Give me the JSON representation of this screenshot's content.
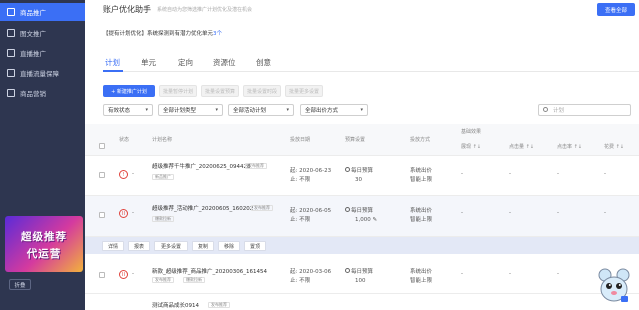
{
  "sidebar": {
    "items": [
      {
        "label": "商品推广",
        "icon": "goods-icon",
        "active": true
      },
      {
        "label": "图文推广",
        "icon": "image-text-icon",
        "active": false
      },
      {
        "label": "直播推广",
        "icon": "live-icon",
        "active": false
      },
      {
        "label": "直播流量保障",
        "icon": "live-traffic-icon",
        "active": false
      },
      {
        "label": "商品营销",
        "icon": "marketing-icon",
        "active": false
      }
    ],
    "promo": {
      "line1": "超级推荐",
      "line2": "代运营"
    },
    "collapse_label": "折叠"
  },
  "header": {
    "title": "账户优化助手",
    "subtitle": "系统自动为您筛选推广计划优化及潜在机会",
    "view_all": "查看全部",
    "notice_prefix": "【提有计划优化】系统探测到有潜力优化单元",
    "notice_count": "3个"
  },
  "tabs": [
    {
      "label": "计划",
      "active": true
    },
    {
      "label": "单元",
      "active": false
    },
    {
      "label": "定向",
      "active": false
    },
    {
      "label": "资源位",
      "active": false
    },
    {
      "label": "创意",
      "active": false
    }
  ],
  "toolbar": {
    "new_plan": "+ 新建推广计划",
    "batch_pause": "批量暂停计划",
    "batch_budget": "批量设置预算",
    "batch_schedule": "批量设置时段",
    "batch_more": "批量更多设置"
  },
  "filters": [
    {
      "value": "有效状态"
    },
    {
      "value": "全部计划类型"
    },
    {
      "value": "全部活动计划"
    },
    {
      "value": "全部出价方式"
    }
  ],
  "search": {
    "placeholder": "计划"
  },
  "table": {
    "headers": {
      "status": "状态",
      "plan_name": "计划名称",
      "schedule": "投放日期",
      "budget": "预算设置",
      "bid_method": "投放方式",
      "group": "基础效果",
      "impressions": "展现 ↑↓",
      "clicks": "点击量 ↑↓",
      "ctr": "点击率 ↑↓",
      "cost": "花费 ↑↓"
    },
    "rows": [
      {
        "status_icon": "!",
        "status_text": "-",
        "name": "超级推荐千牛推广_20200625_094428",
        "tag1": "发布推荐",
        "tag2": "新品推广",
        "start": "起: 2020-06-23",
        "end": "止: 不限",
        "budget_label": "每日预算",
        "budget_value": "30",
        "bid_line1": "系统出价",
        "bid_line2": "智能上限",
        "m1": "-",
        "m2": "-",
        "m3": "-",
        "m4": "-"
      },
      {
        "status_icon": "II",
        "status_text": "-",
        "name": "超级推荐_活动推广_20200605_160202",
        "tag1": "发布推荐",
        "tag2": "爆款拉新",
        "start": "起: 2020-06-05",
        "end": "止: 不限",
        "budget_label": "每日预算",
        "budget_value": "1,000",
        "bid_line1": "系统出价",
        "bid_line2": "智能上限",
        "m1": "-",
        "m2": "-",
        "m3": "-",
        "m4": "-"
      },
      {
        "status_icon": "II",
        "status_text": "-",
        "name": "新款_超级推荐_商品推广_20200306_161454",
        "tag1": "发布推荐",
        "tag2": "爆款拉新",
        "start": "起: 2020-03-06",
        "end": "止: 不限",
        "budget_label": "每日预算",
        "budget_value": "100",
        "bid_line1": "系统出价",
        "bid_line2": "智能上限",
        "m1": "-",
        "m2": "-",
        "m3": "-",
        "m4": "-"
      },
      {
        "name": "测试商品成长0914",
        "tag1": "发布推荐"
      }
    ]
  },
  "row_actions": [
    "详情",
    "报表",
    "更多设置",
    "复制",
    "移除",
    "置顶"
  ],
  "colors": {
    "accent": "#3b6ff5",
    "sidebar_bg": "#2e3650",
    "status_red": "#e0443e"
  }
}
